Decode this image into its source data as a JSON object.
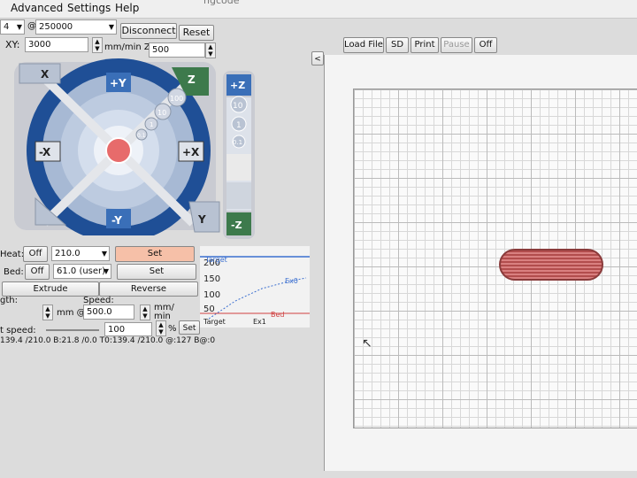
{
  "menu": {
    "items": [
      "Advanced",
      "Settings",
      "Help"
    ],
    "window_title_partial": "ngcode"
  },
  "connection": {
    "port": "4",
    "baud_prefix": "@",
    "baud": "250000",
    "disconnect": "Disconnect",
    "reset": "Reset"
  },
  "feed": {
    "xy_label": "XY:",
    "xy_value": "3000",
    "unit": "mm/min Z:",
    "z_value": "500"
  },
  "jog": {
    "home_x": "X",
    "home_z": "Z",
    "home_y": "Y",
    "home_all": "",
    "plus_y": "+Y",
    "minus_y": "-Y",
    "minus_x": "-X",
    "plus_x": "+X",
    "center": "",
    "steps": [
      "100",
      "10",
      "1",
      "0.1"
    ],
    "z_plus": "+Z",
    "z_minus": "-Z",
    "z_steps": [
      "10",
      "1",
      "0.1"
    ]
  },
  "temp": {
    "heat_label": "Heat:",
    "heat_off": "Off",
    "heat_value": "210.0",
    "heat_set": "Set",
    "bed_label": "Bed:",
    "bed_off": "Off",
    "bed_value": "61.0 (user)",
    "bed_set": "Set",
    "extrude": "Extrude",
    "reverse": "Reverse"
  },
  "extrusion": {
    "length_label": "gth:",
    "speed_label": "Speed:",
    "mm_at": "mm @",
    "speed_value": "500.0",
    "speed_unit_1": "mm/",
    "speed_unit_2": "min",
    "print_speed_label": "t speed:",
    "print_speed_value": "100",
    "percent": "%",
    "set": "Set"
  },
  "status_line": "139.4 /210.0 B:21.8 /0.0 T0:139.4 /210.0 @:127 B@:0",
  "graph": {
    "y_ticks": [
      "200",
      "150",
      "100",
      "50"
    ],
    "labels": {
      "target_top": "Target",
      "ex0": "Ex0",
      "bed": "Bed",
      "target_bottom": "Target",
      "ex1": "Ex1"
    }
  },
  "tabs": {
    "load_file": "Load File",
    "sd": "SD",
    "print": "Print",
    "pause": "Pause",
    "off": "Off",
    "collapse": "<"
  },
  "colors": {
    "jog_blue": "#3a6fb8",
    "home_green": "#3d7a4c",
    "set_active": "#f6c0a8",
    "part_red": "#c96a6a",
    "graph_blue": "#3b6fd0",
    "graph_red": "#d04040"
  }
}
